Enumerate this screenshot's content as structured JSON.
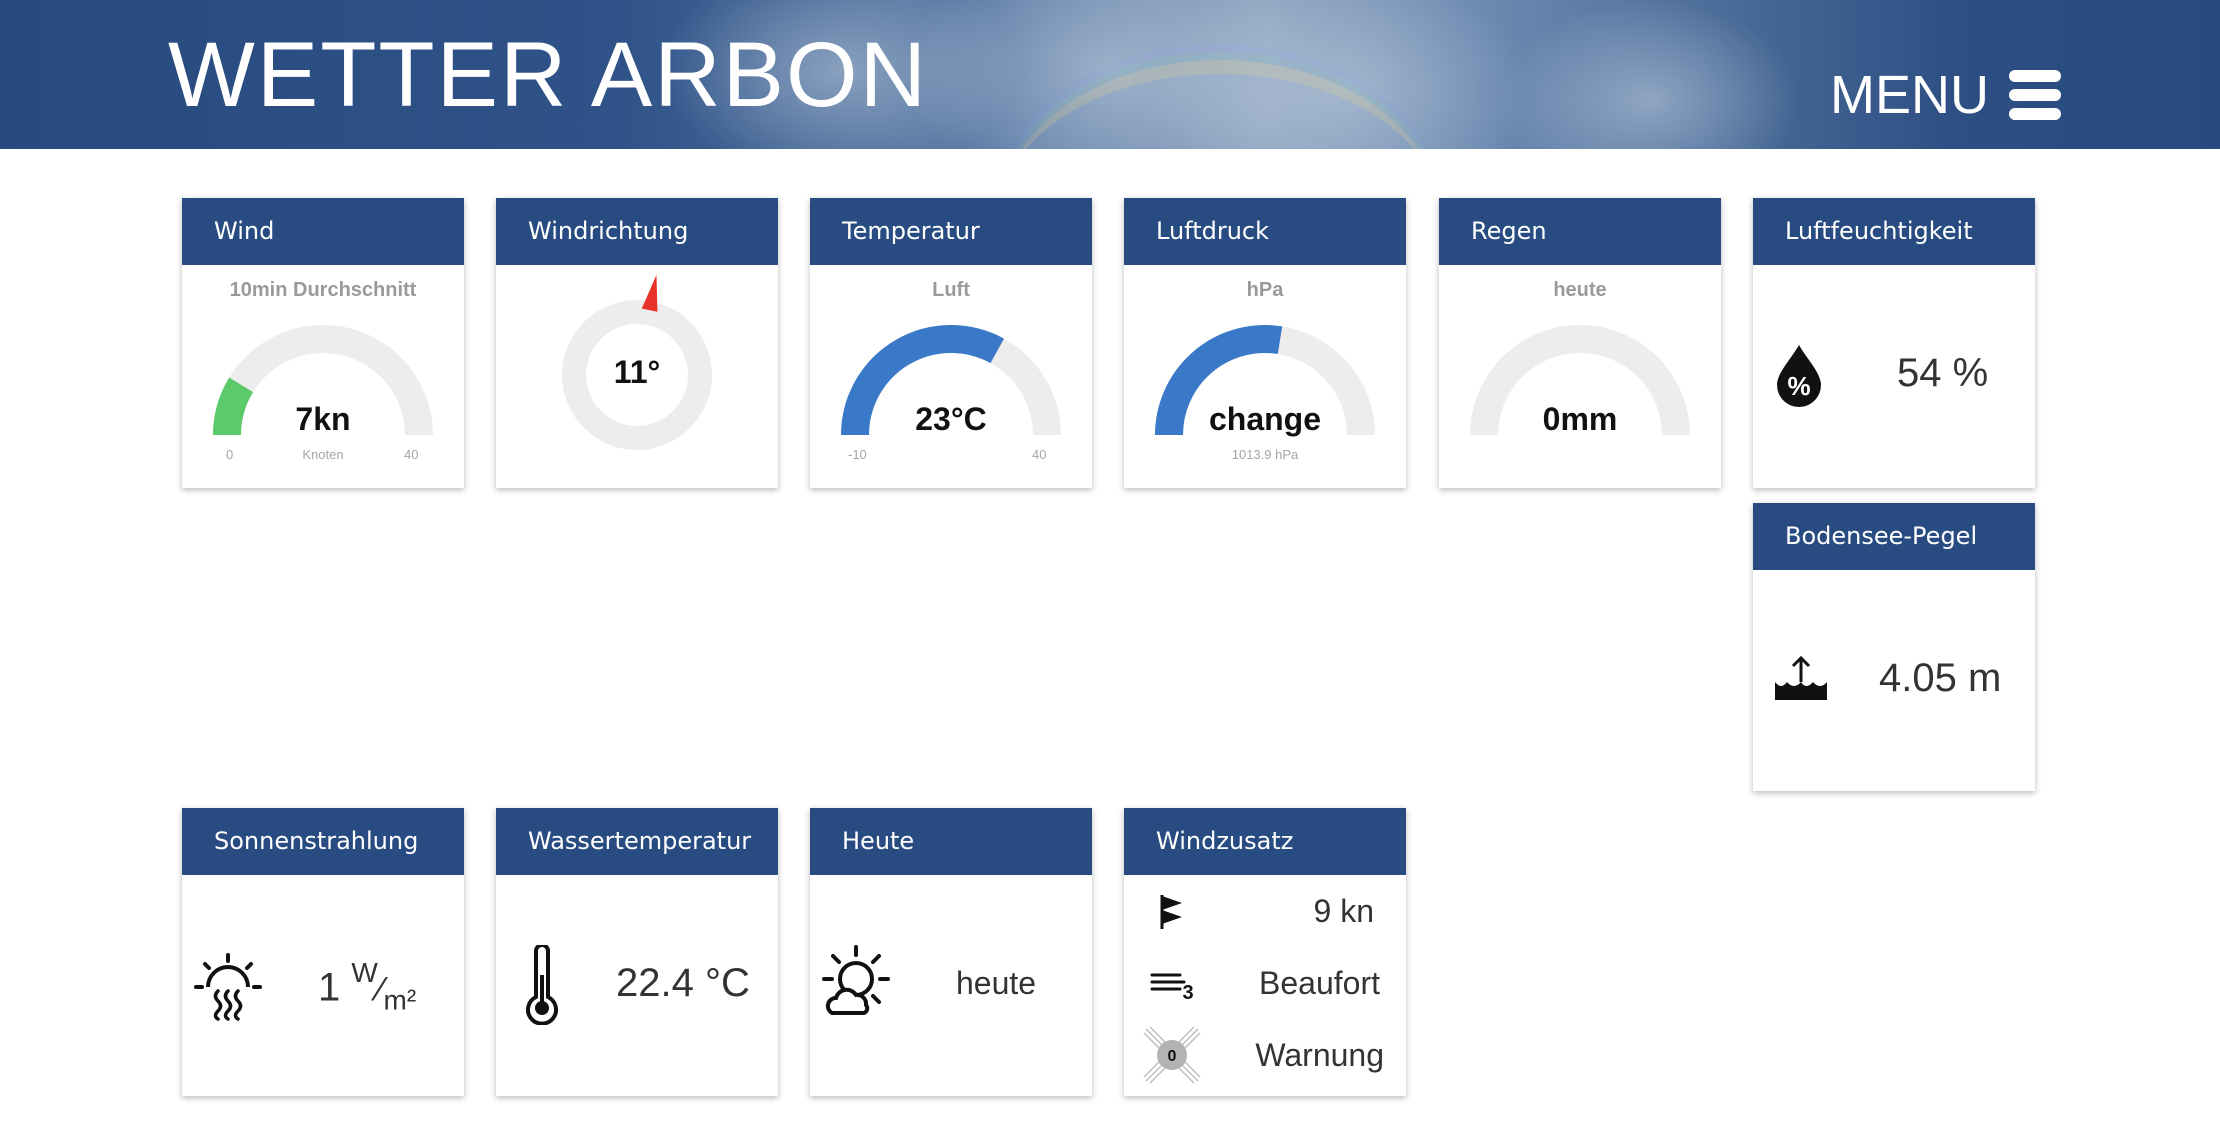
{
  "header": {
    "title": "WETTER ARBON",
    "menu_label": "MENU"
  },
  "cards": {
    "wind": {
      "title": "Wind",
      "subtitle": "10min Durchschnitt",
      "value": "7kn",
      "min_label": "0",
      "max_label": "40",
      "unit_label": "Knoten",
      "gauge": {
        "value": 7,
        "min": 0,
        "max": 40,
        "color": "#5cc96a"
      }
    },
    "windrichtung": {
      "title": "Windrichtung",
      "value": "11°",
      "direction_deg": 11,
      "needle_color": "#e8322a"
    },
    "temperatur": {
      "title": "Temperatur",
      "subtitle": "Luft",
      "value": "23°C",
      "min_label": "-10",
      "max_label": "40",
      "gauge": {
        "value": 23,
        "min": -10,
        "max": 40,
        "color": "#3a78c8"
      }
    },
    "luftdruck": {
      "title": "Luftdruck",
      "subtitle": "hPa",
      "value": "change",
      "small_label": "1013.9 hPa",
      "gauge": {
        "fraction": 0.55,
        "color": "#3a78c8"
      }
    },
    "regen": {
      "title": "Regen",
      "subtitle": "heute",
      "value": "0mm",
      "gauge": {
        "fraction": 0,
        "color": "#3a78c8"
      }
    },
    "luftfeuchtigkeit": {
      "title": "Luftfeuchtigkeit",
      "value": "54 %",
      "icon": "humidity-drop-icon"
    },
    "pegel": {
      "title": "Bodensee-Pegel",
      "value": "4.05 m",
      "icon": "water-level-icon"
    },
    "sonnenstrahlung": {
      "title": "Sonnenstrahlung",
      "value": "1",
      "unit_num": "W",
      "unit_den": "m²",
      "icon": "sun-heat-icon"
    },
    "wassertemperatur": {
      "title": "Wassertemperatur",
      "value": "22.4 °C",
      "icon": "thermometer-icon"
    },
    "heute": {
      "title": "Heute",
      "value": "heute",
      "icon": "sun-cloud-icon"
    },
    "windzusatz": {
      "title": "Windzusatz",
      "rows": [
        {
          "icon": "flag-icon",
          "value": "9 kn"
        },
        {
          "icon": "beaufort-wind-icon",
          "value": "Beaufort"
        },
        {
          "icon": "warning-light-icon",
          "value": "Warnung",
          "badge": "0"
        }
      ]
    }
  },
  "colors": {
    "header_bg": "#284c82",
    "card_header_bg": "#284c82",
    "gauge_track": "#eeeded"
  }
}
